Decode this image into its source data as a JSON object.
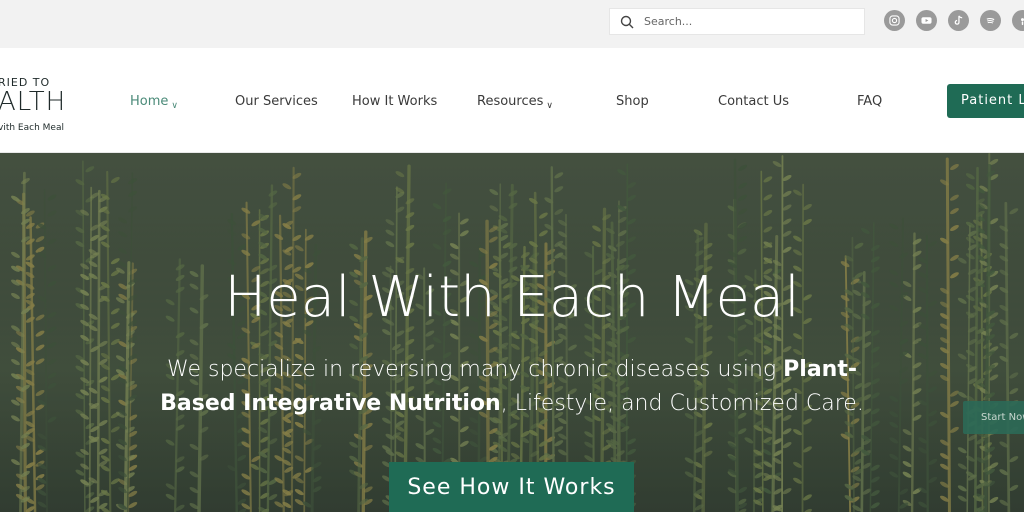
{
  "search": {
    "placeholder": "Search..."
  },
  "socials": [
    {
      "icon": "instagram-icon"
    },
    {
      "icon": "youtube-icon"
    },
    {
      "icon": "tiktok-icon"
    },
    {
      "icon": "spotify-icon"
    },
    {
      "icon": "apple-podcasts-icon"
    }
  ],
  "logo": {
    "line1": "RIED TO",
    "line2": "ALTH",
    "tagline": "vith Each Meal"
  },
  "nav": {
    "home": "Home",
    "services": "Our Services",
    "how": "How It Works",
    "resources": "Resources",
    "shop": "Shop",
    "contact": "Contact Us",
    "faq": "FAQ",
    "patient_button": "Patient Lo"
  },
  "hero": {
    "title": "Heal With Each Meal",
    "sub_part1": "We specialize in reversing many chronic diseases using ",
    "sub_bold1": "Plant-Based Integrative Nutrition",
    "sub_part2": ", Lifestyle, and Customized Care.",
    "cta": "See How It Works",
    "side_button": "Start Now"
  },
  "colors": {
    "brand": "#1f6b55",
    "nav_active": "#4a8a78"
  }
}
